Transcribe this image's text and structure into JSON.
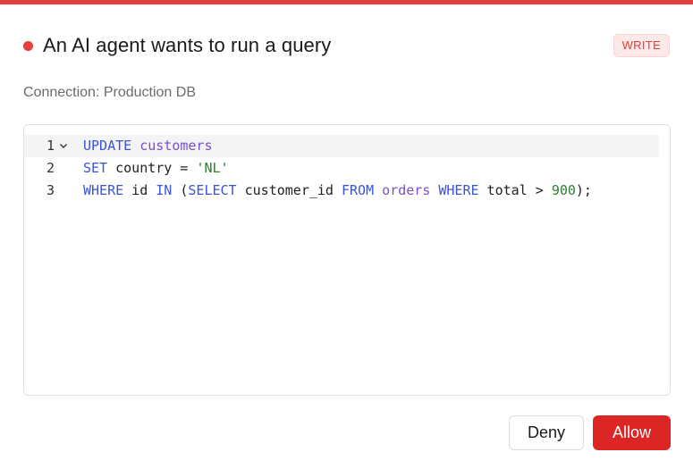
{
  "dialog": {
    "title": "An AI agent wants to run a query",
    "badge": "WRITE",
    "connection": "Connection: Production DB"
  },
  "editor": {
    "lines": [
      {
        "number": "1",
        "tokens": [
          {
            "t": "UPDATE",
            "k": "kw"
          },
          {
            "t": " "
          },
          {
            "t": "customers",
            "k": "ident"
          }
        ]
      },
      {
        "number": "2",
        "tokens": [
          {
            "t": "SET",
            "k": "kw"
          },
          {
            "t": " country = "
          },
          {
            "t": "'NL'",
            "k": "str"
          }
        ]
      },
      {
        "number": "3",
        "tokens": [
          {
            "t": "WHERE",
            "k": "kw"
          },
          {
            "t": " id "
          },
          {
            "t": "IN",
            "k": "kw"
          },
          {
            "t": " ("
          },
          {
            "t": "SELECT",
            "k": "kw"
          },
          {
            "t": " customer_id "
          },
          {
            "t": "FROM",
            "k": "kw"
          },
          {
            "t": " "
          },
          {
            "t": "orders",
            "k": "ident"
          },
          {
            "t": " "
          },
          {
            "t": "WHERE",
            "k": "kw"
          },
          {
            "t": " total > "
          },
          {
            "t": "900",
            "k": "num"
          },
          {
            "t": ");"
          }
        ]
      }
    ],
    "fold_icon": "chevron-down-icon",
    "active_line": 1
  },
  "actions": {
    "deny_label": "Deny",
    "allow_label": "Allow"
  },
  "colors": {
    "accent": "#e5403b",
    "allow": "#dc2626",
    "keyword": "#3b53d8",
    "identifier": "#7a4fc9",
    "string": "#2e7d32"
  }
}
